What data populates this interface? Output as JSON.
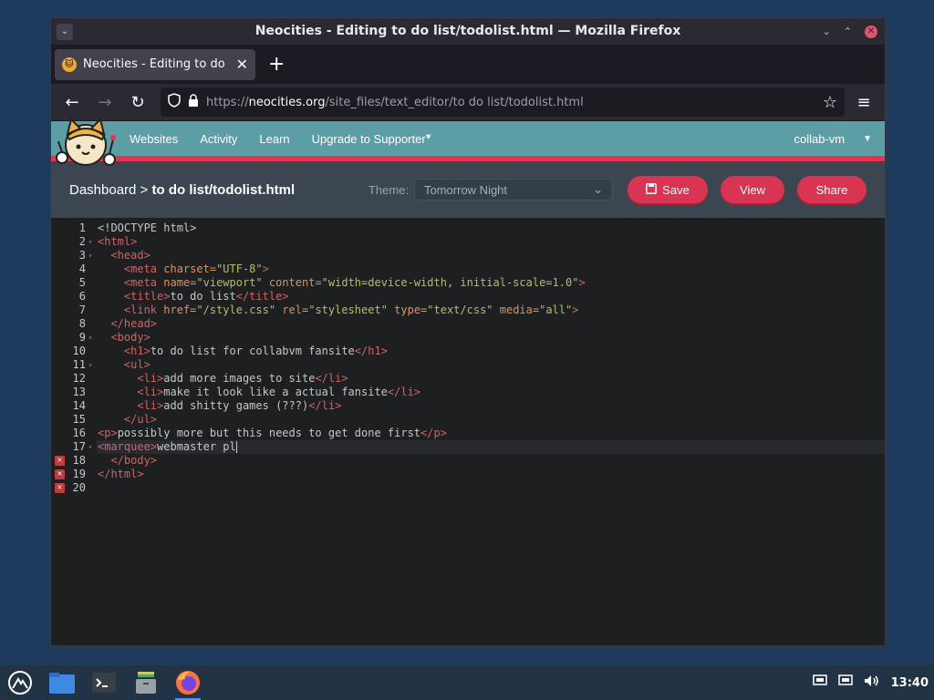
{
  "window": {
    "title": "Neocities - Editing to do list/todolist.html — Mozilla Firefox",
    "menu_glyph": "⌄",
    "min_glyph": "⌄",
    "max_glyph": "⌃",
    "close_glyph": "✕"
  },
  "tabs": [
    {
      "label": "Neocities - Editing to do list/todolist.html",
      "close": "✕"
    }
  ],
  "newtab_glyph": "+",
  "nav": {
    "back": "←",
    "forward": "→",
    "reload": "↻",
    "url_prefix": "https://",
    "url_host": "neocities.org",
    "url_path": "/site_files/text_editor/to do list/todolist.html",
    "star": "☆",
    "menu": "≡"
  },
  "site": {
    "nav_items": [
      "Websites",
      "Activity",
      "Learn",
      "Upgrade to Supporter"
    ],
    "heart": "♥",
    "user": "collab-vm",
    "user_caret": "▼"
  },
  "toolbar": {
    "breadcrumb_root": "Dashboard",
    "breadcrumb_sep": " > ",
    "breadcrumb_file": "to do list/todolist.html",
    "theme_label": "Theme:",
    "theme_value": "Tomorrow Night",
    "theme_caret": "⌄",
    "save_icon": "🖫",
    "save_label": "Save",
    "view_label": "View",
    "share_label": "Share"
  },
  "editor": {
    "lines": [
      {
        "n": "1",
        "fold": "",
        "err": ""
      },
      {
        "n": "2",
        "fold": "▾",
        "err": ""
      },
      {
        "n": "3",
        "fold": "▾",
        "err": ""
      },
      {
        "n": "4",
        "fold": "",
        "err": ""
      },
      {
        "n": "5",
        "fold": "",
        "err": ""
      },
      {
        "n": "6",
        "fold": "",
        "err": ""
      },
      {
        "n": "7",
        "fold": "",
        "err": ""
      },
      {
        "n": "8",
        "fold": "",
        "err": ""
      },
      {
        "n": "9",
        "fold": "▾",
        "err": ""
      },
      {
        "n": "10",
        "fold": "",
        "err": ""
      },
      {
        "n": "11",
        "fold": "▾",
        "err": ""
      },
      {
        "n": "12",
        "fold": "",
        "err": ""
      },
      {
        "n": "13",
        "fold": "",
        "err": ""
      },
      {
        "n": "14",
        "fold": "",
        "err": ""
      },
      {
        "n": "15",
        "fold": "",
        "err": ""
      },
      {
        "n": "16",
        "fold": "",
        "err": ""
      },
      {
        "n": "17",
        "fold": "▾",
        "err": ""
      },
      {
        "n": "18",
        "fold": "",
        "err": "✕"
      },
      {
        "n": "19",
        "fold": "",
        "err": "✕"
      },
      {
        "n": "20",
        "fold": "",
        "err": "✕"
      }
    ],
    "code": {
      "l1": "<!DOCTYPE html>",
      "l2_tag": "<html>",
      "l3_tag": "<head>",
      "l4_tag_open": "<meta",
      "l4_attr": " charset=",
      "l4_val": "\"UTF-8\"",
      "l4_close": ">",
      "l5_tag_open": "<meta",
      "l5_attr1": " name=",
      "l5_val1": "\"viewport\"",
      "l5_attr2": " content=",
      "l5_val2": "\"width=device-width, initial-scale=1.0\"",
      "l5_close": ">",
      "l6_open": "<title>",
      "l6_text": "to do list",
      "l6_close": "</title>",
      "l7_tag_open": "<link",
      "l7_attr1": " href=",
      "l7_val1": "\"/style.css\"",
      "l7_attr2": " rel=",
      "l7_val2": "\"stylesheet\"",
      "l7_attr3": " type=",
      "l7_val3": "\"text/css\"",
      "l7_attr4": " media=",
      "l7_val4": "\"all\"",
      "l7_close": ">",
      "l8_tag": "</head>",
      "l9_tag": "<body>",
      "l10_open": "<h1>",
      "l10_text": "to do list for collabvm fansite",
      "l10_close": "</h1>",
      "l11_tag": "<ul>",
      "l12_open": "<li>",
      "l12_text": "add more images to site",
      "l12_close": "</li>",
      "l13_open": "<li>",
      "l13_text": "make it look like a actual fansite",
      "l13_close": "</li>",
      "l14_open": "<li>",
      "l14_text": "add shitty games (???)",
      "l14_close": "</li>",
      "l15_tag": "</ul>",
      "l16_open": "<p>",
      "l16_text": "possibly more but this needs to get done first",
      "l16_close": "</p>",
      "l17_open": "<marquee>",
      "l17_text": "webmaster pl",
      "l18_tag": "</body>",
      "l19_tag": "</html>"
    }
  },
  "taskbar": {
    "clock": "13:40"
  }
}
